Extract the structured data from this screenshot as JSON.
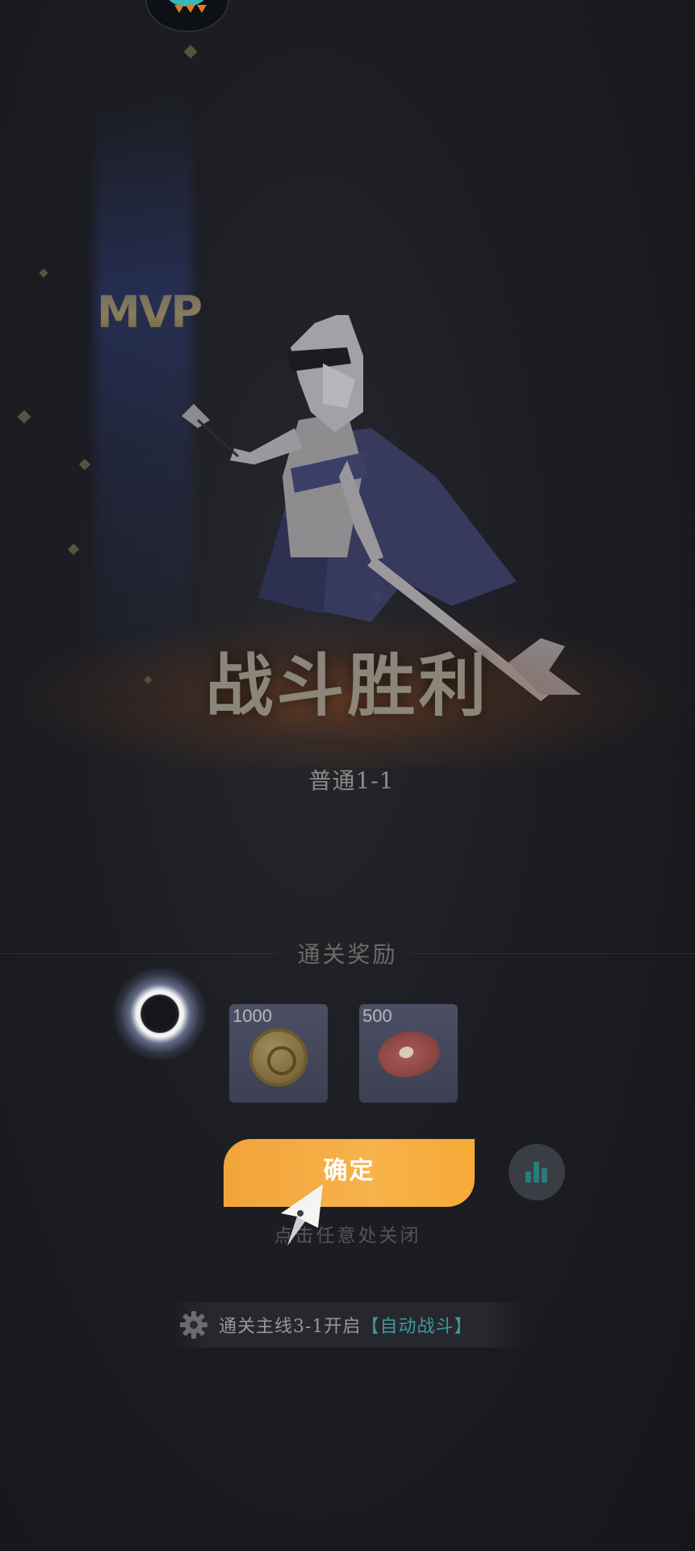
{
  "header": {
    "avatar_icon": "creature-avatar-icon"
  },
  "mvp": {
    "label": "MVP"
  },
  "result": {
    "title": "战斗胜利",
    "stage": "普通1-1"
  },
  "rewards": {
    "title": "通关奖励",
    "items": [
      {
        "icon": "gold-coin-icon",
        "count": "1000"
      },
      {
        "icon": "meat-icon",
        "count": "500"
      }
    ]
  },
  "actions": {
    "confirm_label": "确定",
    "stats_icon": "bar-chart-icon",
    "close_hint": "点击任意处关闭"
  },
  "unlock_tip": {
    "icon": "gear-icon",
    "text": "通关主线3-1开启",
    "feature": "【自动战斗】"
  },
  "colors": {
    "accent_orange": "#f7b24a",
    "teal": "#3d9a9b",
    "background": "#1c1d22"
  }
}
